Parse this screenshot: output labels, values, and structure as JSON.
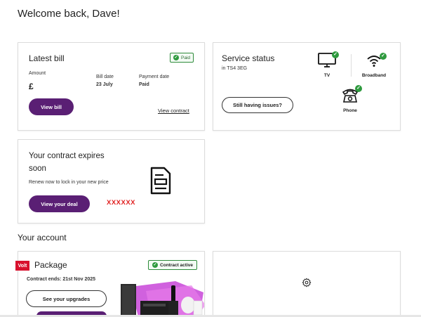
{
  "greeting": "Welcome back, Dave!",
  "latest_bill": {
    "title": "Latest bill",
    "badge": "Paid",
    "amount_label": "Amount",
    "amount_value": "£",
    "bill_date_label": "Bill date",
    "bill_date_value": "23 July",
    "payment_date_label": "Payment date",
    "payment_date_value": "Paid",
    "view_bill_button": "View bill",
    "view_contract_link": "View contract"
  },
  "service_status": {
    "title": "Service status",
    "location": "in TS4 3EG",
    "issues_button": "Still having issues?",
    "services": [
      {
        "label": "TV",
        "icon": "tv-icon"
      },
      {
        "label": "Broadband",
        "icon": "wifi-icon"
      },
      {
        "label": "Phone",
        "icon": "phone-icon"
      }
    ]
  },
  "contract_expiry": {
    "title_line1": "Your contract expires",
    "title_line2": "soon",
    "subtitle": "Renew now to lock in your new price",
    "deal_button": "View your deal",
    "redacted_text": "XXXXXX",
    "icon": "document-icon"
  },
  "your_account": {
    "section_title": "Your account",
    "package": {
      "brand_tag": "Volt",
      "title": "Package",
      "badge": "Contract active",
      "contract_ends": "Contract ends: 21st Nov 2025",
      "upgrades_button": "See your upgrades"
    },
    "settings_icon": "gear-icon"
  },
  "colors": {
    "brand_purple": "#5a1f74",
    "success_green": "#2e9a3e",
    "redacted_red": "#e02020",
    "volt_red": "#d8112e"
  }
}
